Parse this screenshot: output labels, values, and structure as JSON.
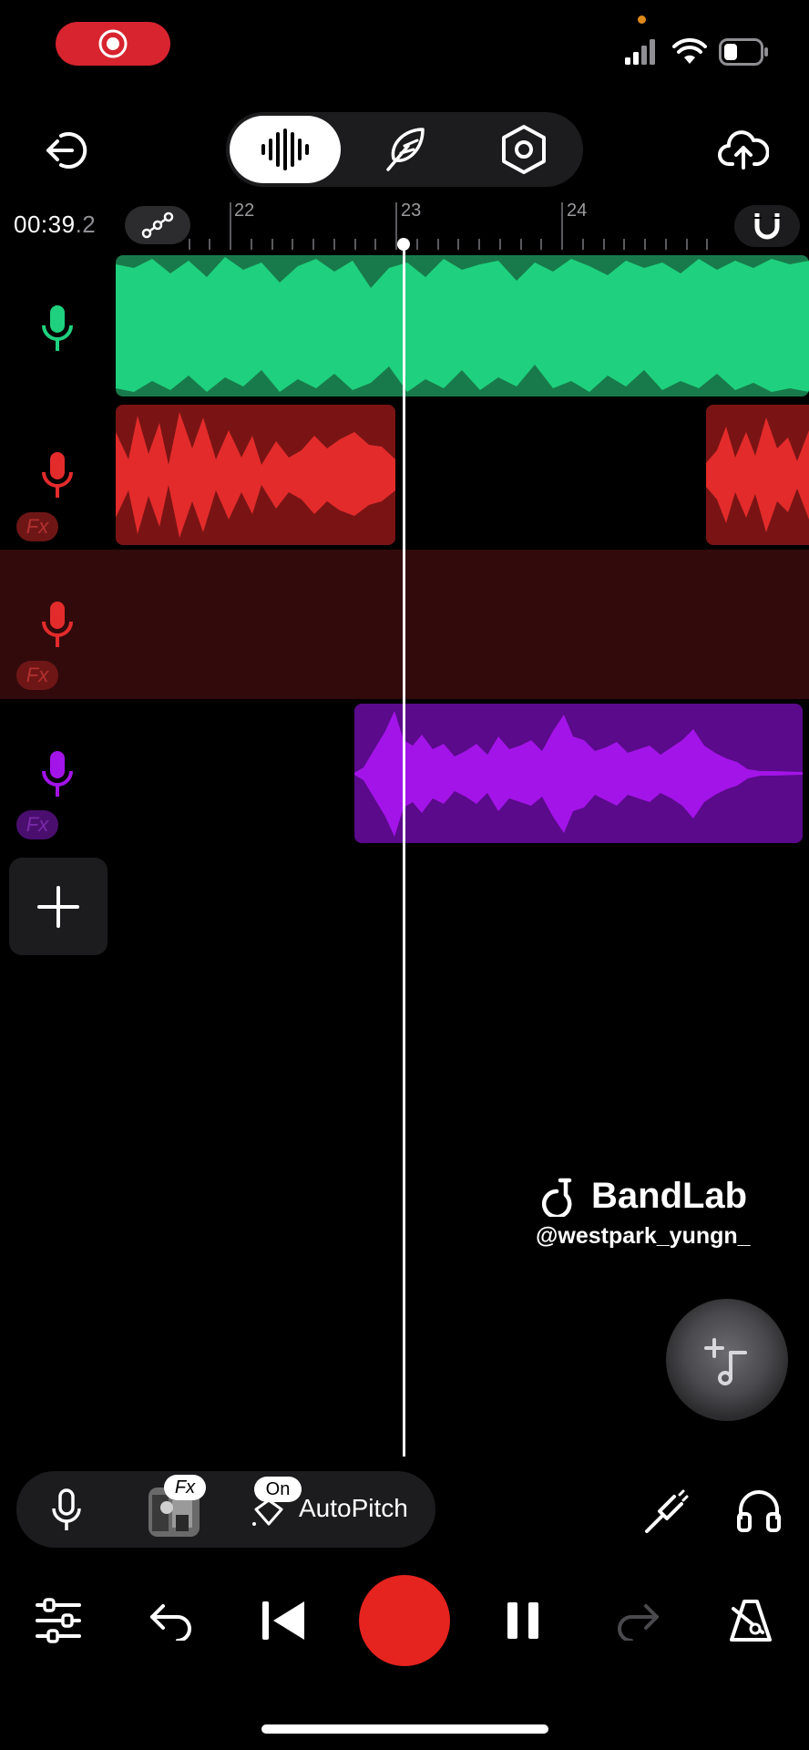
{
  "status_bar": {
    "record_indicator": "screen-record-icon",
    "icons": [
      "signal-icon",
      "wifi-icon",
      "battery-icon"
    ],
    "camera_dot_color": "#e08a1a"
  },
  "toolbar": {
    "exit_icon": "exit-icon",
    "modes": [
      "waveform-icon",
      "feather-icon",
      "settings-hex-icon"
    ],
    "active_mode": "waveform-icon",
    "upload_icon": "cloud-upload-icon"
  },
  "timeline": {
    "time_main": "00:39",
    "time_frac": ".2",
    "ruler_labels": [
      "22",
      "23",
      "24"
    ],
    "automation_icon": "automation-icon",
    "snap_icon": "magnet-icon"
  },
  "tracks": [
    {
      "name": "track-1",
      "color": "#1fd17e",
      "fx": false
    },
    {
      "name": "track-2",
      "color": "#e32b2b",
      "fx": true,
      "fx_label": "Fx"
    },
    {
      "name": "track-3",
      "color": "#e32b2b",
      "fx": true,
      "fx_label": "Fx",
      "selected": true
    },
    {
      "name": "track-4",
      "color": "#a314e8",
      "fx": true,
      "fx_label": "Fx"
    }
  ],
  "watermark": {
    "brand": "BandLab",
    "handle": "@westpark_yungn_"
  },
  "chain": {
    "fx_tag": "Fx",
    "on_tag": "On",
    "autopitch": "AutoPitch"
  },
  "transport": {
    "record_color": "#e5231f",
    "icons": [
      "mixer-icon",
      "undo-icon",
      "skip-back-icon",
      "record-button",
      "pause-icon",
      "redo-icon",
      "metronome-icon"
    ]
  }
}
